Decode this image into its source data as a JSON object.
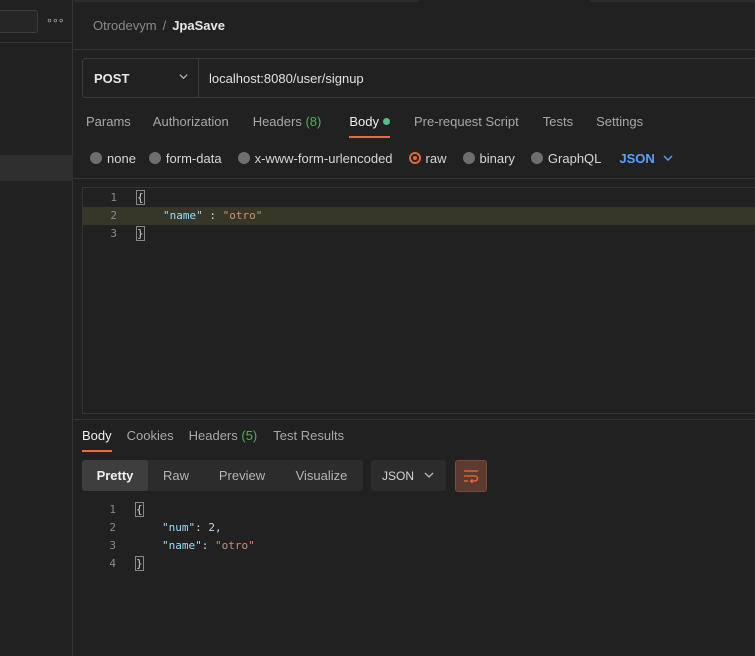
{
  "breadcrumb": {
    "collection": "Otrodevym",
    "separator": "/",
    "request": "JpaSave"
  },
  "sidebar": {
    "more_label": "∘∘∘"
  },
  "request": {
    "method": "POST",
    "url": "localhost:8080/user/signup"
  },
  "request_tabs": [
    {
      "label": "Params"
    },
    {
      "label": "Authorization"
    },
    {
      "label": "Headers",
      "count": "(8)"
    },
    {
      "label": "Body",
      "active": true
    },
    {
      "label": "Pre-request Script"
    },
    {
      "label": "Tests"
    },
    {
      "label": "Settings"
    }
  ],
  "body_types": [
    {
      "label": "none",
      "selected": false
    },
    {
      "label": "form-data",
      "selected": false
    },
    {
      "label": "x-www-form-urlencoded",
      "selected": false
    },
    {
      "label": "raw",
      "selected": true
    },
    {
      "label": "binary",
      "selected": false
    },
    {
      "label": "GraphQL",
      "selected": false
    }
  ],
  "raw_format": "JSON",
  "request_body": {
    "line_numbers": [
      "1",
      "2",
      "3"
    ],
    "lines": [
      "{",
      "    \"name\" : \"otro\"",
      "}"
    ],
    "key": "\"name\"",
    "colon": " : ",
    "value": "\"otro\"",
    "open": "{",
    "close": "}"
  },
  "response_tabs": [
    {
      "label": "Body",
      "active": true
    },
    {
      "label": "Cookies"
    },
    {
      "label": "Headers",
      "count": "(5)"
    },
    {
      "label": "Test Results"
    }
  ],
  "view_modes": [
    {
      "label": "Pretty",
      "active": true
    },
    {
      "label": "Raw"
    },
    {
      "label": "Preview"
    },
    {
      "label": "Visualize"
    }
  ],
  "response_format": "JSON",
  "response_body": {
    "line_numbers": [
      "1",
      "2",
      "3",
      "4"
    ],
    "open": "{",
    "close": "}",
    "num_key": "\"num\"",
    "num_value": "2",
    "name_key": "\"name\"",
    "name_value": "\"otro\""
  },
  "colors": {
    "accent": "#ef6a3a",
    "background": "#212121",
    "link_blue": "#5aa1ff",
    "success_green": "#4caf50"
  }
}
